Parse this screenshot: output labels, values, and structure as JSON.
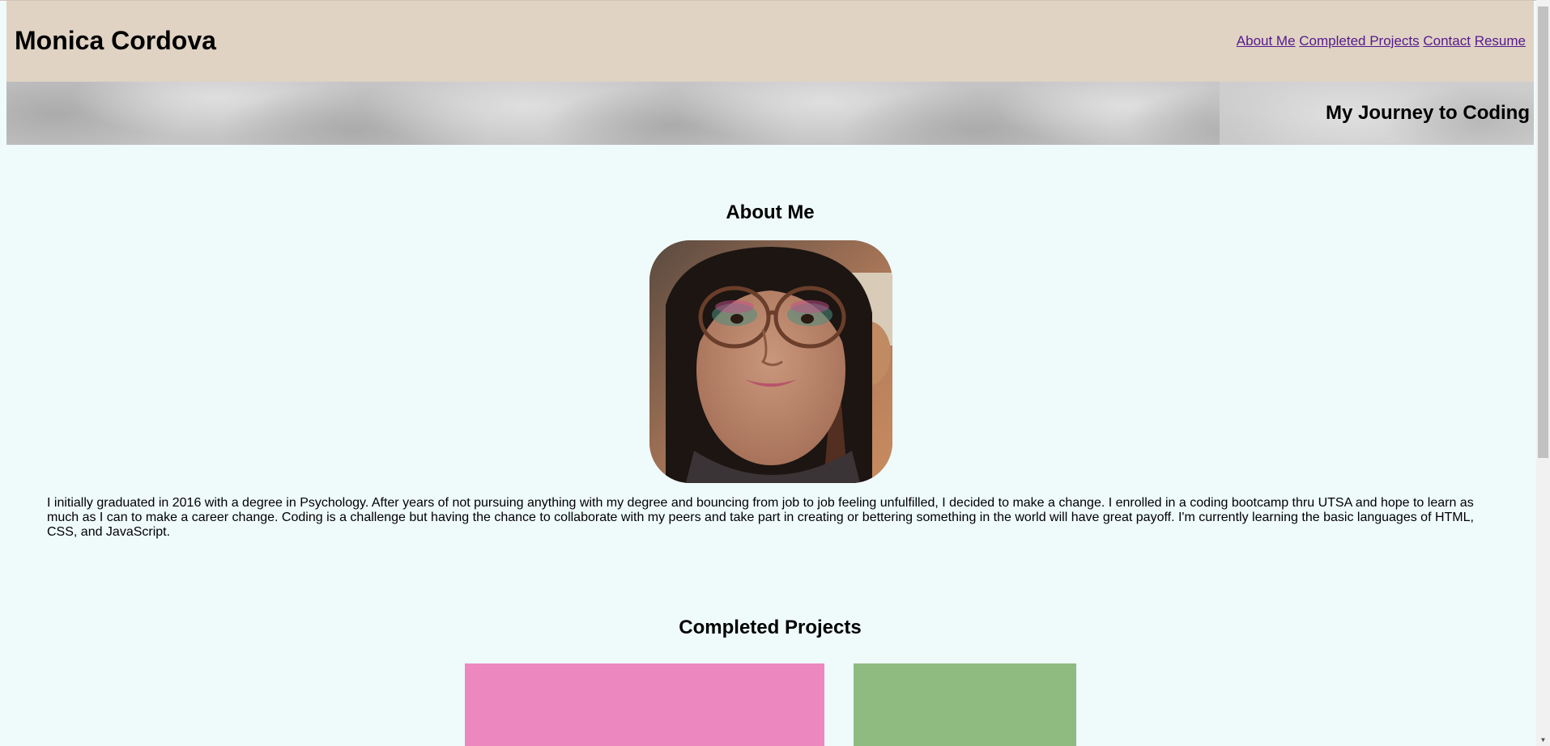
{
  "header": {
    "title": "Monica Cordova",
    "bg_color": "#e0d3c4",
    "nav": [
      {
        "label": "About Me"
      },
      {
        "label": "Completed Projects"
      },
      {
        "label": "Contact"
      },
      {
        "label": "Resume"
      }
    ]
  },
  "hero": {
    "title": "My Journey to Coding"
  },
  "about": {
    "heading": "About Me",
    "photo_icon": "profile-photo",
    "bio": "I initially graduated in 2016 with a degree in Psychology. After years of not pursuing anything with my degree and bouncing from job to job feeling unfulfilled, I decided to make a change. I enrolled in a coding bootcamp thru UTSA and hope to learn as much as I can to make a career change. Coding is a challenge but having the chance to collaborate with my peers and take part in creating or bettering something in the world will have great payoff. I'm currently learning the basic languages of HTML, CSS, and JavaScript."
  },
  "projects": {
    "heading": "Completed Projects",
    "cards": [
      {
        "color": "#ec88bf"
      },
      {
        "color": "#8fba80"
      }
    ]
  },
  "colors": {
    "page_bg": "#effafb",
    "link": "#551a8b"
  }
}
